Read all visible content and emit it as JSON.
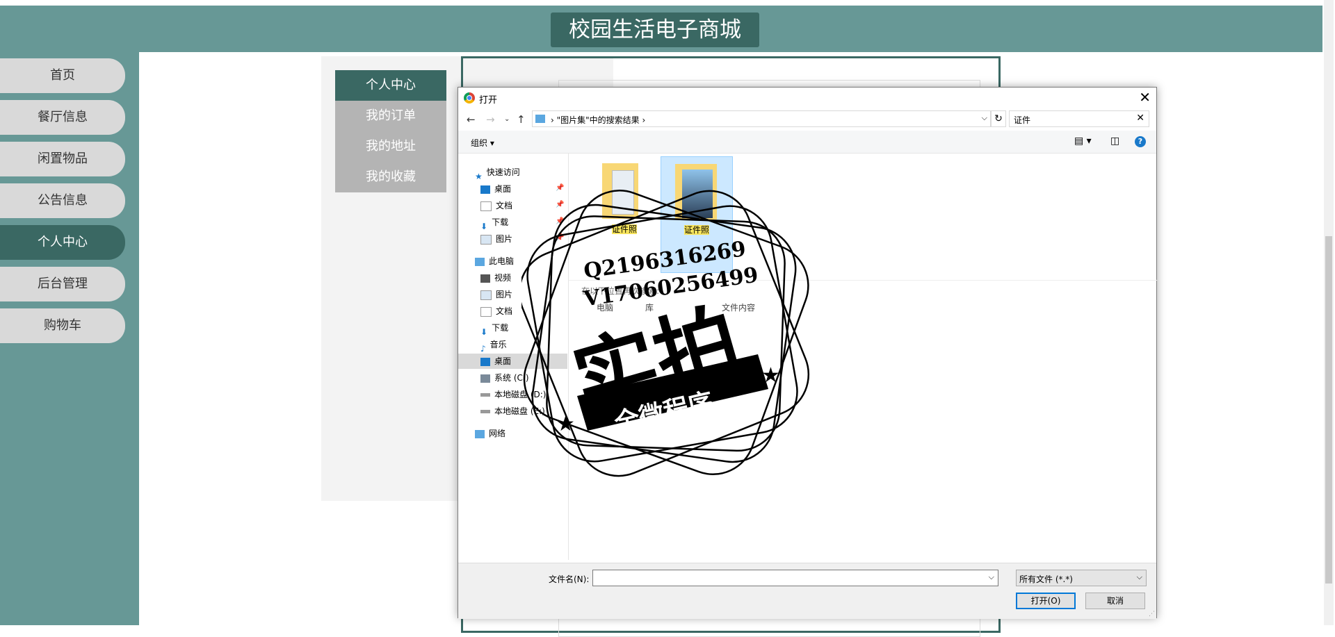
{
  "site": {
    "title": "校园生活电子商城"
  },
  "leftnav": {
    "items": [
      "首页",
      "餐厅信息",
      "闲置物品",
      "公告信息",
      "个人中心",
      "后台管理",
      "购物车"
    ]
  },
  "submenu": {
    "items": [
      "个人中心",
      "我的订单",
      "我的地址",
      "我的收藏"
    ]
  },
  "dialog": {
    "title": "打开",
    "address": "\"图片集\"中的搜索结果",
    "search_value": "证件",
    "organize": "组织 ▾",
    "tree": [
      "快速访问",
      "桌面",
      "文档",
      "下载",
      "图片",
      "此电脑",
      "视频",
      "图片",
      "文档",
      "下载",
      "音乐",
      "桌面",
      "系统 (C:)",
      "本地磁盘 (D:)",
      "本地磁盘 (E:)",
      "网络"
    ],
    "files": [
      {
        "name": "证件照"
      },
      {
        "name": "证件照"
      }
    ],
    "search_again": "在以下位置再次搜索:",
    "search_again_options": [
      "电脑",
      "库",
      "文件内容"
    ],
    "filename_label": "文件名(N):",
    "filename_value": "",
    "filetype": "所有文件 (*.*)",
    "open_button": "打开(O)",
    "cancel_button": "取消"
  },
  "watermark": {
    "line1": "Q2196316269",
    "line2": "V17060256499",
    "big": "实拍",
    "ribbon": "全微程序"
  }
}
